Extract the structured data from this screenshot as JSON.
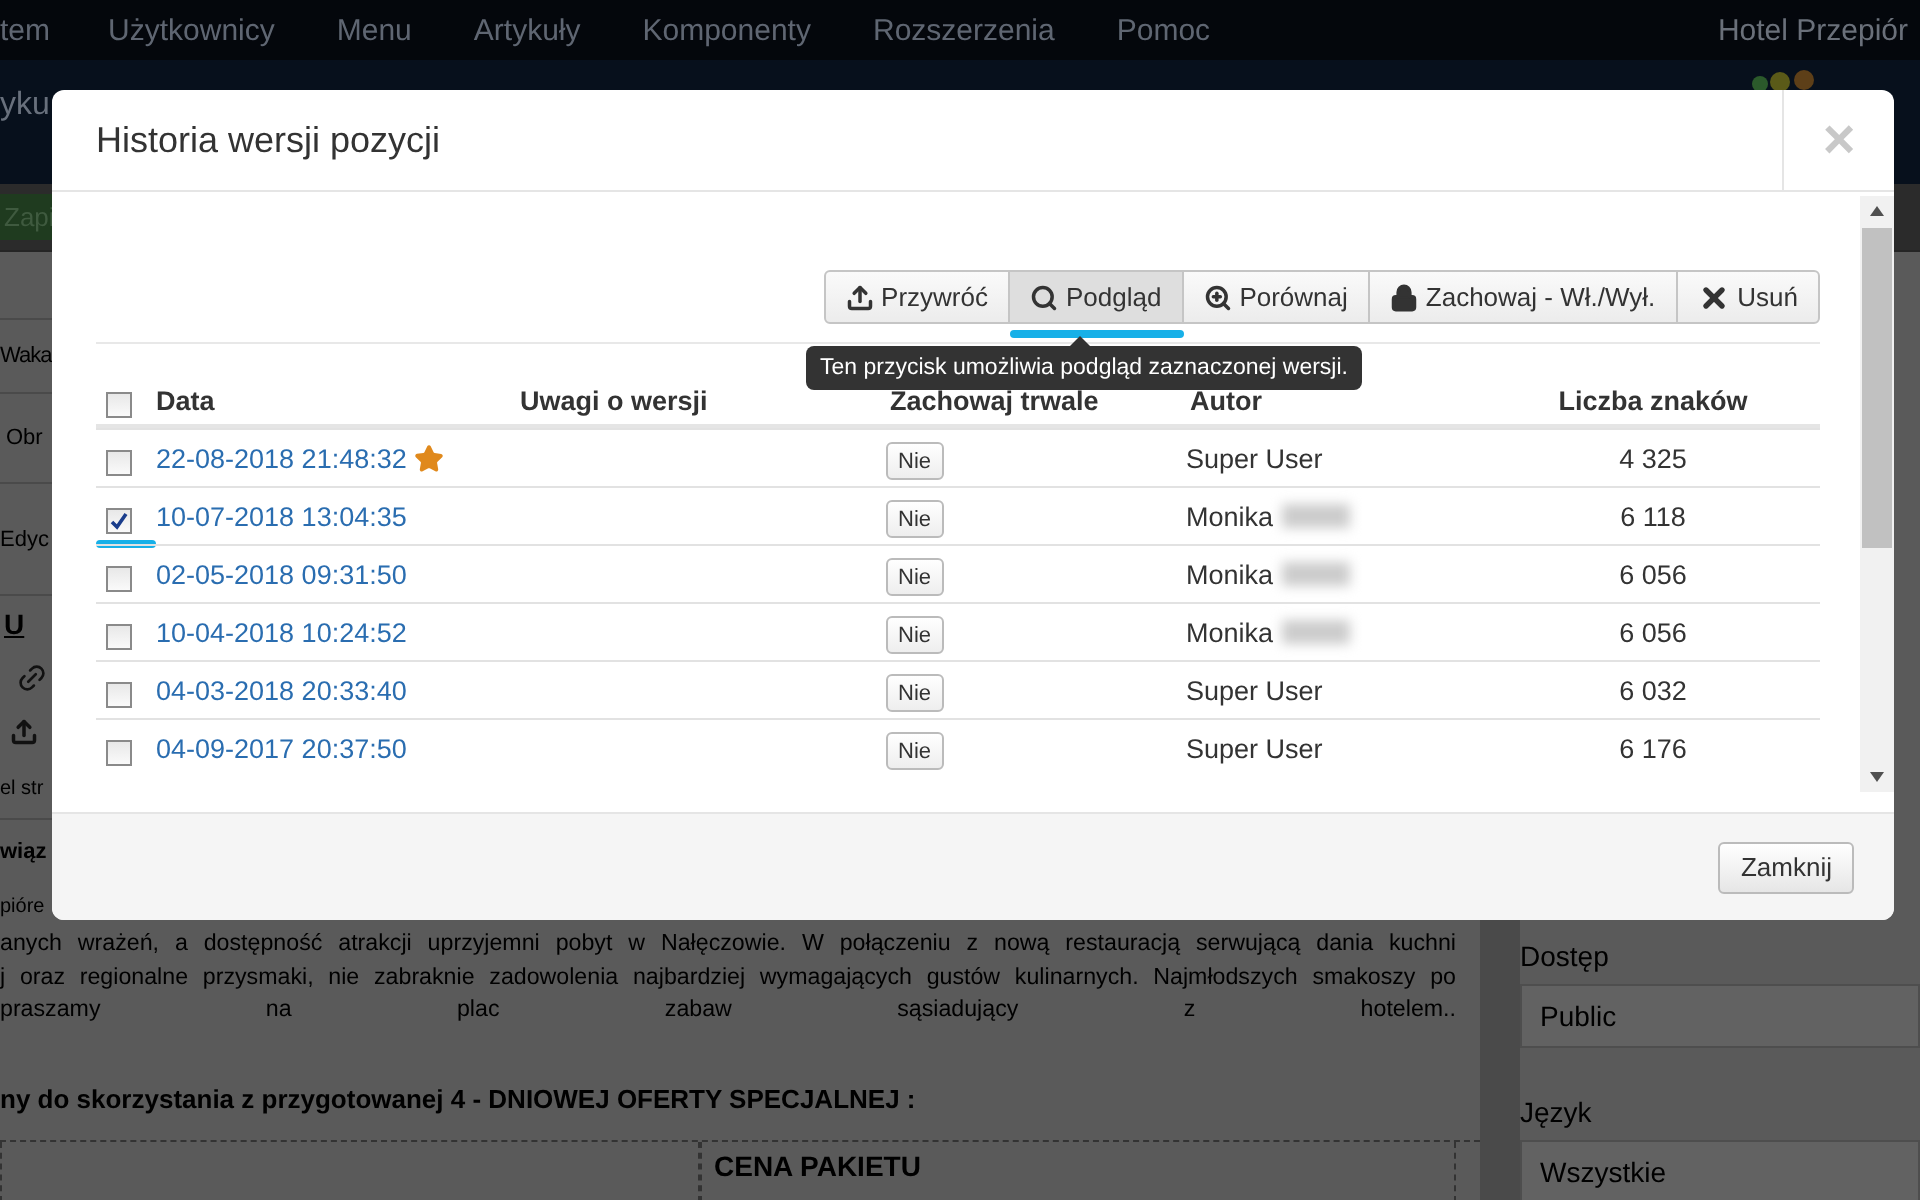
{
  "top_menu": {
    "items": [
      "tem",
      "Użytkownicy",
      "Menu",
      "Artykuły",
      "Komponenty",
      "Rozszerzenia",
      "Pomoc"
    ],
    "site_name": "Hotel Przepiór"
  },
  "header": {
    "title": "yku"
  },
  "toolbar": {
    "save_button": "Zapi"
  },
  "left_strip": {
    "tab_title": "Waka",
    "tab": "Obr",
    "editor_menu": "Edyc",
    "underline_button": "U",
    "label": "el str",
    "section": "wiąz",
    "text": "pióre"
  },
  "content": {
    "paragraph": [
      "anych wrażeń, a dostępność atrakcji uprzyjemni pobyt w Nałęczowie. W połączeniu z nową restauracją serwującą dania kuchni",
      "j oraz regionalne przysmaki, nie zabraknie zadowolenia najbardziej wymagających gustów kulinarnych. Najmłodszych smakoszy po",
      "praszamy na plac zabaw sąsiadujący z hotelem.."
    ],
    "offer_heading": "ny do skorzystania z przygotowanej 4 - DNIOWEJ OFERTY SPECJALNEJ :",
    "table_header": "CENA PAKIETU"
  },
  "sidebar": {
    "fields": [
      {
        "label": "Dostęp",
        "value": "Public"
      },
      {
        "label": "Język",
        "value": "Wszystkie"
      }
    ]
  },
  "dialog": {
    "title": "Historia wersji pozycji",
    "close": "×",
    "actions": [
      {
        "label": "Przywróć",
        "kind": "restore",
        "active": false,
        "highlighted": false
      },
      {
        "label": "Podgląd",
        "kind": "preview",
        "active": true,
        "highlighted": true
      },
      {
        "label": "Porównaj",
        "kind": "compare",
        "active": false,
        "highlighted": false
      },
      {
        "label": "Zachowaj - Wł./Wył.",
        "kind": "keep",
        "active": false,
        "highlighted": false
      },
      {
        "label": "Usuń",
        "kind": "delete",
        "active": false,
        "highlighted": false
      }
    ],
    "tooltip": "Ten przycisk umożliwia podgląd zaznaczonej wersji.",
    "columns": [
      "Data",
      "Uwagi o wersji",
      "Zachowaj trwale",
      "Autor",
      "Liczba znaków"
    ],
    "select_all_checked": false,
    "rows": [
      {
        "date": "22-08-2018 21:48:32",
        "current": true,
        "keep": "Nie",
        "author": "Super User",
        "author_blurred": false,
        "chars": "4 325",
        "checked": false,
        "highlighted": false
      },
      {
        "date": "10-07-2018 13:04:35",
        "current": false,
        "keep": "Nie",
        "author": "Monika",
        "author_blurred": true,
        "chars": "6 118",
        "checked": true,
        "highlighted": true
      },
      {
        "date": "02-05-2018 09:31:50",
        "current": false,
        "keep": "Nie",
        "author": "Monika",
        "author_blurred": true,
        "chars": "6 056",
        "checked": false,
        "highlighted": false
      },
      {
        "date": "10-04-2018 10:24:52",
        "current": false,
        "keep": "Nie",
        "author": "Monika",
        "author_blurred": true,
        "chars": "6 056",
        "checked": false,
        "highlighted": false
      },
      {
        "date": "04-03-2018 20:33:40",
        "current": false,
        "keep": "Nie",
        "author": "Super User",
        "author_blurred": false,
        "chars": "6 032",
        "checked": false,
        "highlighted": false
      },
      {
        "date": "04-09-2017 20:37:50",
        "current": false,
        "keep": "Nie",
        "author": "Super User",
        "author_blurred": false,
        "chars": "6 176",
        "checked": false,
        "highlighted": false
      }
    ],
    "footer_button": "Zamknij"
  }
}
